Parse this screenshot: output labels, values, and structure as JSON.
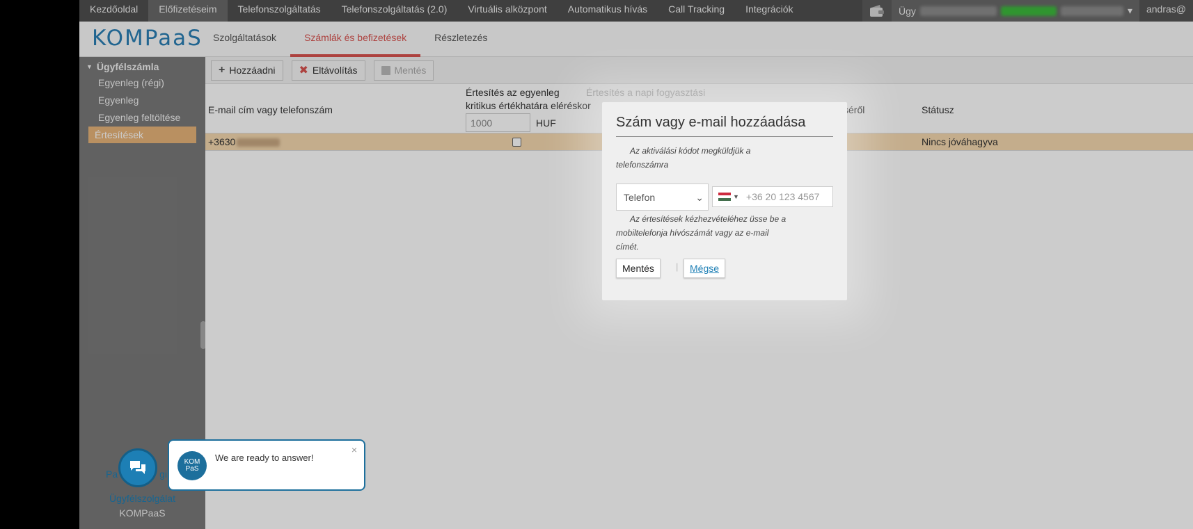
{
  "topnav": {
    "items": [
      "Kezdőoldal",
      "Előfizetéseim",
      "Telefonszolgáltatás",
      "Telefonszolgáltatás (2.0)",
      "Virtuális alközpont",
      "Automatikus hívás",
      "Call Tracking",
      "Integrációk"
    ],
    "account_label": "Ügy",
    "user_label": "andras@"
  },
  "header": {
    "logo": "KOMPaaS",
    "tabs": [
      "Szolgáltatások",
      "Számlák és befizetések",
      "Részletezés"
    ]
  },
  "sidebar": {
    "group": "Ügyfélszámla",
    "items": [
      "Egyenleg (régi)",
      "Egyenleg",
      "Egyenleg feltöltése",
      "Értesítések"
    ],
    "bottom_link": "Ügyfélszolgálat",
    "bottom_brand": "KOMPaaS",
    "partial_link": "Pa",
    "partial_link2": "gi"
  },
  "toolbar": {
    "add": "Hozzáadni",
    "remove": "Eltávolítás",
    "save": "Mentés"
  },
  "table": {
    "col_contact": "E-mail cím vagy telefonszám",
    "col_critical_line1": "Értesítés az egyenleg",
    "col_critical_line2": "kritikus értékhatára eléréskor",
    "critical_value": "1000",
    "critical_unit": "HUF",
    "col_daily": "Értesítés a napi fogyasztási",
    "col_daily_tail": "séről",
    "col_status": "Státusz",
    "row_contact": "+3630",
    "row_status": "Nincs jóváhagyva"
  },
  "modal": {
    "title": "Szám vagy e-mail hozzáadása",
    "note1": "Az aktiválási kódot megküldjük a telefonszámra",
    "type_value": "Telefon",
    "phone_placeholder": "+36 20 123 4567",
    "note2": "Az értesítések kézhezvételéhez üsse be a mobiltelefonja hívószámát vagy az e-mail címét.",
    "save": "Mentés",
    "separator": "|",
    "cancel": "Mégse"
  },
  "chat": {
    "message": "We are ready to answer!",
    "avatar_text": "KOM PaS",
    "close": "×"
  },
  "colors": {
    "accent_red": "#d9534f",
    "brand_blue": "#1d7fb5",
    "row_highlight": "#f5d9b0"
  }
}
